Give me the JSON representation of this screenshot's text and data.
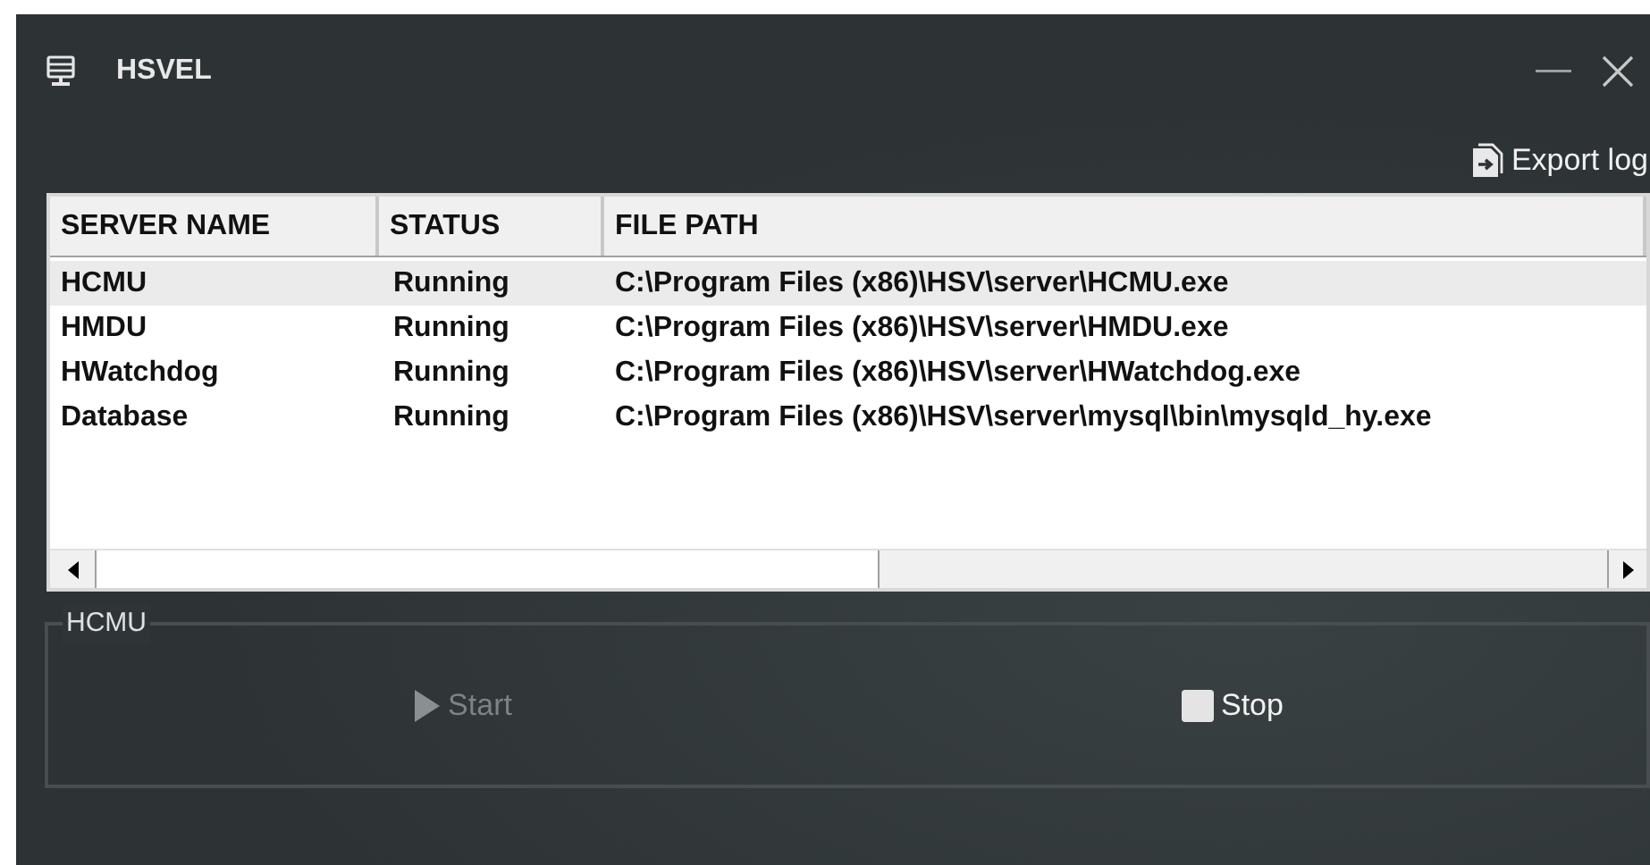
{
  "window": {
    "title": "HSVEL"
  },
  "toolbar": {
    "export_label": "Export log"
  },
  "table": {
    "columns": [
      "SERVER NAME",
      "STATUS",
      "FILE PATH"
    ],
    "rows": [
      {
        "name": "HCMU",
        "status": "Running",
        "path": "C:\\Program Files (x86)\\HSV\\server\\HCMU.exe",
        "selected": true
      },
      {
        "name": "HMDU",
        "status": "Running",
        "path": "C:\\Program Files (x86)\\HSV\\server\\HMDU.exe",
        "selected": false
      },
      {
        "name": "HWatchdog",
        "status": "Running",
        "path": "C:\\Program Files (x86)\\HSV\\server\\HWatchdog.exe",
        "selected": false
      },
      {
        "name": "Database",
        "status": "Running",
        "path": "C:\\Program Files (x86)\\HSV\\server\\mysql\\bin\\mysqld_hy.exe",
        "selected": false
      }
    ]
  },
  "group": {
    "title": "HCMU",
    "buttons": [
      {
        "label": "Start",
        "kind": "start",
        "disabled": true
      },
      {
        "label": "Stop",
        "kind": "stop",
        "disabled": false
      }
    ]
  }
}
